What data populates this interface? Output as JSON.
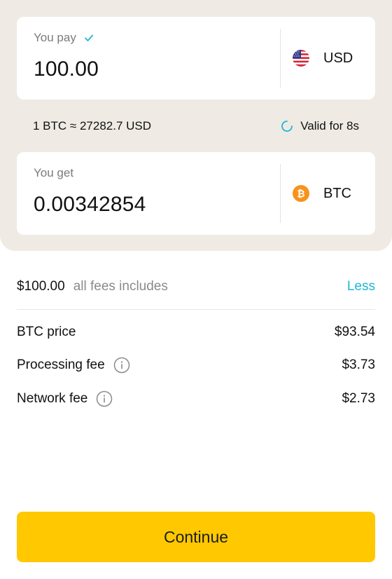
{
  "exchange": {
    "pay": {
      "label": "You pay",
      "amount": "100.00",
      "currency": "USD",
      "currency_icon": "us-flag-icon"
    },
    "rate": "1 BTC ≈ 27282.7 USD",
    "validity": "Valid for 8s",
    "get": {
      "label": "You get",
      "amount": "0.00342854",
      "currency": "BTC",
      "currency_icon": "bitcoin-icon"
    }
  },
  "summary": {
    "total": "$100.00",
    "note": "all fees includes",
    "toggle_label": "Less"
  },
  "fees": [
    {
      "name": "BTC price",
      "value": "$93.54",
      "has_info": false
    },
    {
      "name": "Processing fee",
      "value": "$3.73",
      "has_info": true
    },
    {
      "name": "Network fee",
      "value": "$2.73",
      "has_info": true
    }
  ],
  "actions": {
    "continue_label": "Continue"
  },
  "colors": {
    "accent_button": "#ffc800",
    "link": "#1ab8d6",
    "panel_background": "#efebe4",
    "bitcoin": "#f7931a"
  }
}
